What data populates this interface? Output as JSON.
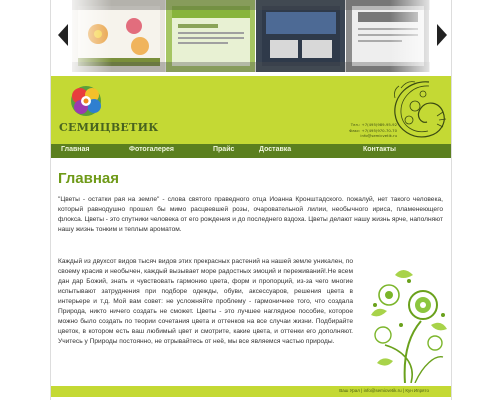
{
  "slider": {
    "prev_icon": "chevron-left-icon",
    "next_icon": "chevron-right-icon"
  },
  "brand": {
    "name": "СЕМИЦВЕТИК",
    "color": "#c4d934"
  },
  "contacts": {
    "line1": "Тел.: +7(495)989-95-92",
    "line2": "Факс: +7(495)970-70-70",
    "line3": "info@semicvetik.ru"
  },
  "nav": {
    "items": [
      "Главная",
      "Фотогалерея",
      "Прайс",
      "Доставка",
      "Контакты"
    ],
    "bg_color": "#5b7f1f"
  },
  "main": {
    "title": "Главная",
    "paragraph1": "\"Цветы - остатки рая на земле\" - слова святого праведного отца Иоанна Кронштадского. пожалуй, нет такого человека, который равнодушно прошел бы мимо расцвевшей розы, очаровательной лилии, необычного ириса, пламенеющего флокса. Цветы - это спутники человека от его рождения и до последнего вздоха. Цветы делают нашу жизнь ярче, наполняют нашу жизнь тонким и теплым ароматом.",
    "paragraph2": "Каждый из двухсот видов тысяч видов этих прекрасных растений на нашей земле уникален, по своему красив и необычен, каждый вызывает море радостных эмоций и переживаний!.Не всем дан дар Божий, знать и чувствовать гармонию цвета, форм и пропорций, из-за чего многие испытывают затруднения при подборе одежды, обуви, аксессуаров, решения цвета в интерьере и т.д. Мой вам совет: не усложняйте проблему - гармоничнее того, что создала Природа, никто ничего создать не сможет. Цветы - это лучшее наглядное пособие, которое можно было создать по теории сочетания цвета и оттенков на все случаи жизни. Подбирайте цветок, в котором есть ваш любимый цвет и смотрите, какие цвета, и оттенки его дополняют. Учитесь у Природы постоянно, не отрывайтесь от неё, мы все являемся частью природы."
  },
  "footer": {
    "text": "Ваш Урал | info@semicvetik.ru | Кун Ипрято"
  }
}
